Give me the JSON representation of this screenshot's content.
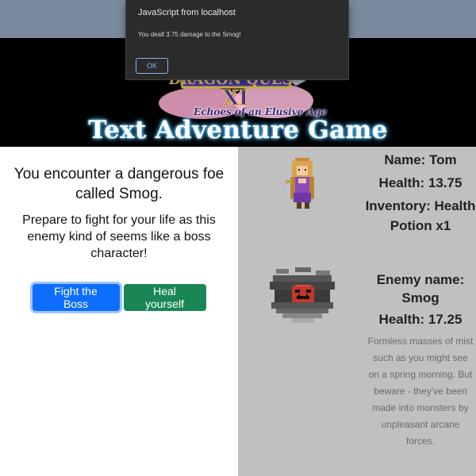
{
  "game": {
    "logo_subtitle": "Echoes of an Elusive Age",
    "title": "Text Adventure Game"
  },
  "story": {
    "encounter_text": "You encounter a dangerous foe called Smog.",
    "prepare_text": "Prepare to fight for your life as this enemy kind of seems like a boss character!"
  },
  "actions": {
    "fight_label": "Fight the Boss",
    "heal_label": "Heal yourself"
  },
  "player": {
    "name_line": "Name: Tom",
    "health_line": "Health: 13.75",
    "inventory_line": "Inventory: Health Potion x1"
  },
  "enemy": {
    "name_line": "Enemy name: Smog",
    "health_line": "Health: 17.25",
    "description": "Formless masses of mist such as you might see on a spring morning. But beware - they've been made into monsters by unpleasant arcane forces."
  },
  "dialog": {
    "title": "JavaScript from localhost",
    "message": "You dealt 3.75 damage to the Smog!",
    "ok_label": "OK"
  },
  "colors": {
    "fight_button": "#0d6efd",
    "heal_button": "#198754",
    "right_panel": "#c0c0c0",
    "hero_bg": "#000000"
  }
}
